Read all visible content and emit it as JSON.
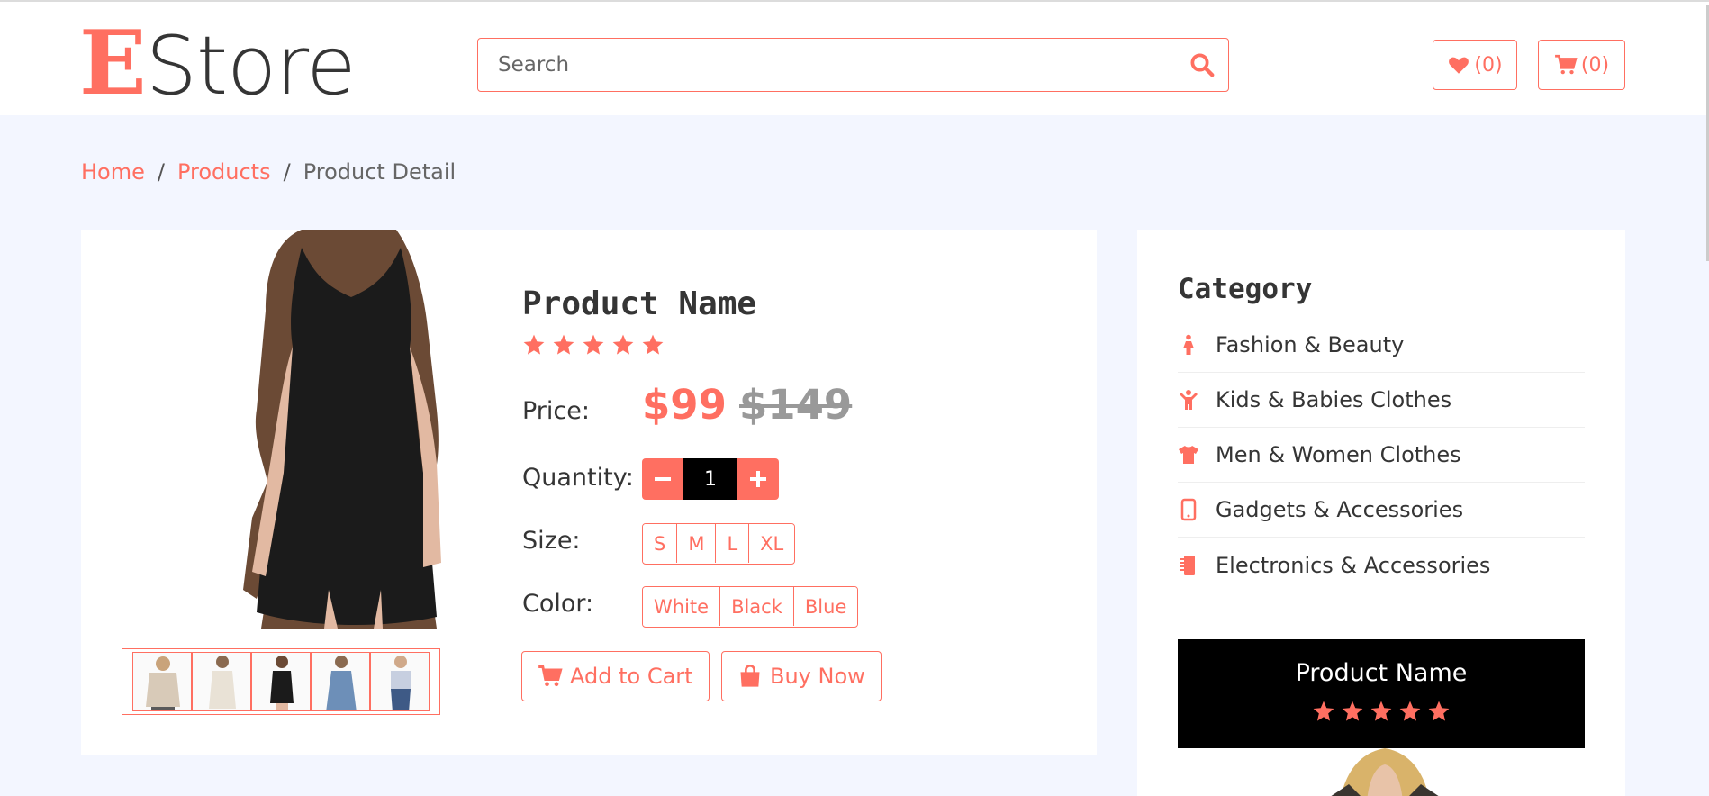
{
  "brand": {
    "logo_first": "E",
    "logo_rest": "Store",
    "accent": "#ff6f61"
  },
  "search": {
    "placeholder": "Search",
    "value": ""
  },
  "header": {
    "wishlist_count": "(0)",
    "cart_count": "(0)"
  },
  "breadcrumb": {
    "home": "Home",
    "products": "Products",
    "current": "Product Detail",
    "separator": "/"
  },
  "product": {
    "name": "Product Name",
    "rating": 5,
    "price_label": "Price:",
    "price": "$99",
    "old_price": "$149",
    "quantity_label": "Quantity:",
    "quantity": "1",
    "size_label": "Size:",
    "sizes": [
      "S",
      "M",
      "L",
      "XL"
    ],
    "color_label": "Color:",
    "colors": [
      "White",
      "Black",
      "Blue"
    ],
    "add_to_cart": "Add to Cart",
    "buy_now": "Buy Now"
  },
  "sidebar": {
    "category_title": "Category",
    "categories": [
      {
        "label": "Fashion & Beauty",
        "icon": "female-icon"
      },
      {
        "label": "Kids & Babies Clothes",
        "icon": "child-icon"
      },
      {
        "label": "Men & Women Clothes",
        "icon": "tshirt-icon"
      },
      {
        "label": "Gadgets & Accessories",
        "icon": "mobile-icon"
      },
      {
        "label": "Electronics & Accessories",
        "icon": "microchip-icon"
      }
    ],
    "promo": {
      "name": "Product Name",
      "rating": 5
    }
  }
}
